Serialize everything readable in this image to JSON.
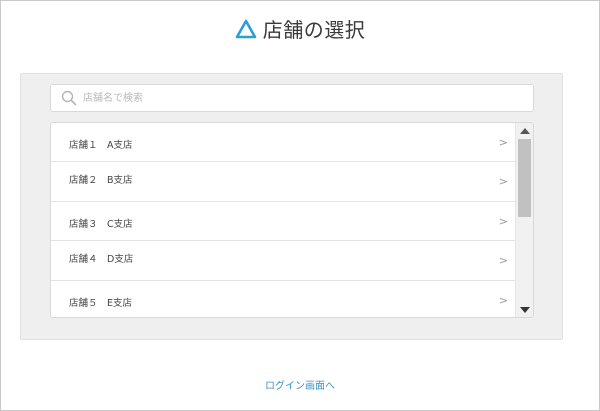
{
  "header": {
    "title": "店舗の選択",
    "logo_icon": "triangle-logo-icon",
    "accent_color": "#2a9fd6"
  },
  "search": {
    "placeholder": "店舗名で検索",
    "value": "",
    "icon": "search-icon"
  },
  "stores": [
    {
      "label": "店舗１　A支店"
    },
    {
      "label": "店舗２　B支店"
    },
    {
      "label": "店舗３　C支店"
    },
    {
      "label": "店舗４　D支店"
    },
    {
      "label": "店舗５　E支店"
    }
  ],
  "row_chevron": ">",
  "footer": {
    "login_link": "ログイン画面へ"
  }
}
